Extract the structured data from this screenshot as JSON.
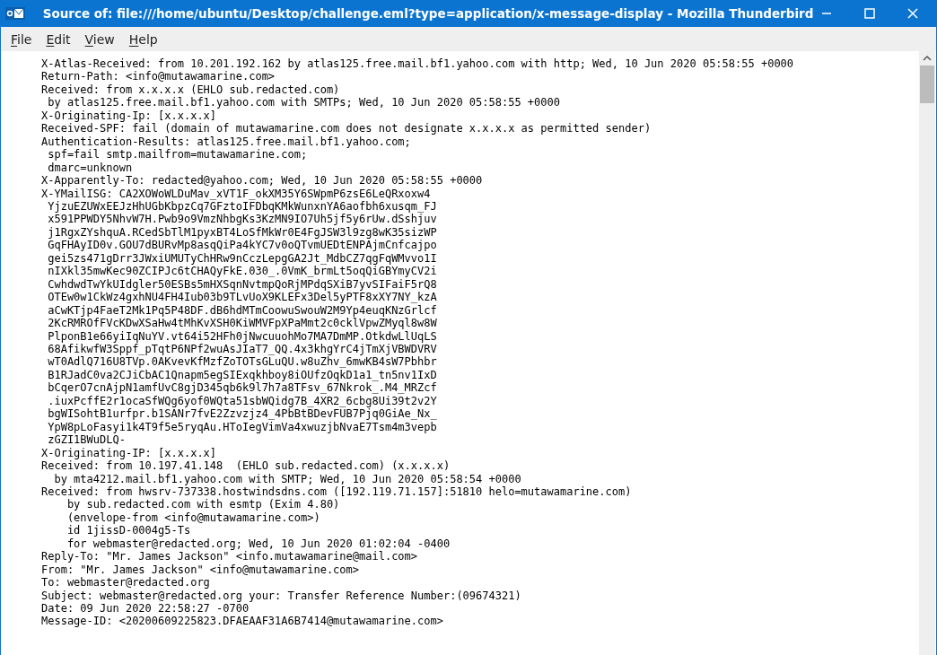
{
  "window": {
    "title": "Source of: file:///home/ubuntu/Desktop/challenge.eml?type=application/x-message-display - Mozilla Thunderbird"
  },
  "menu": [
    {
      "mnemonic": "F",
      "rest": "ile"
    },
    {
      "mnemonic": "E",
      "rest": "dit"
    },
    {
      "mnemonic": "V",
      "rest": "iew"
    },
    {
      "mnemonic": "H",
      "rest": "elp"
    }
  ],
  "source_lines": [
    "X-Atlas-Received: from 10.201.192.162 by atlas125.free.mail.bf1.yahoo.com with http; Wed, 10 Jun 2020 05:58:55 +0000",
    "Return-Path: <info@mutawamarine.com>",
    "Received: from x.x.x.x (EHLO sub.redacted.com)",
    " by atlas125.free.mail.bf1.yahoo.com with SMTPs; Wed, 10 Jun 2020 05:58:55 +0000",
    "X-Originating-Ip: [x.x.x.x]",
    "Received-SPF: fail (domain of mutawamarine.com does not designate x.x.x.x as permitted sender)",
    "Authentication-Results: atlas125.free.mail.bf1.yahoo.com;",
    " spf=fail smtp.mailfrom=mutawamarine.com;",
    " dmarc=unknown",
    "X-Apparently-To: redacted@yahoo.com; Wed, 10 Jun 2020 05:58:55 +0000",
    "X-YMailISG: CA2XOWoWLDuMav_xVT1F_okXM35Y6SWpmP6zsE6LeQRxoxw4",
    " YjzuEZUWxEEJzHhUGbKbpzCq7GFztoIFDbqKMkWunxnYA6aofbh6xusqm_FJ",
    " x591PPWDY5NhvW7H.Pwb9o9VmzNhbgKs3KzMN9IO7Uh5jf5y6rUw.dSshjuv",
    " j1RgxZYshquA.RCedSbTlM1pyxBT4LoSfMkWr0E4FgJSW3l9zg8wK35sizWP",
    " GqFHAyID0v.GOU7dBURvMp8asqQiPa4kYC7v0oQTvmUEDtENPAjmCnfcajpo",
    " gei5zs471gDrr3JWxiUMUTyChHRw9nCczLepgGA2Jt_MdbCZ7qgFqWMvvo1I",
    " nIXkl35mwKec90ZCIPJc6tCHAQyFkE.030_.0VmK_brmLt5oqQiGBYmyCV2i",
    " CwhdwdTwYkUIdgler50ESBs5mHXSqnNvtmpQoRjMPdqSXiB7yvSIFaiF5rQ8",
    " OTEw0w1CkWz4gxhNU4FH4Iub03b9TLvUoX9KLEFx3Del5yPTF8xXY7NY_kzA",
    " aCwKTjp4FaeT2Mk1Pq5P48DF.dB6hdMTmCoowuSwouW2M9Yp4euqKNzGrlcf",
    " 2KcRMROfFVcKDwXSaHw4tMhKvXSH0KiWMVFpXPaMmt2c0cklVpwZMyql8w8W",
    " PlponB1e66yiIqNuYV.vt64i52HFh0jNwcuuohMo7MA7DmMP.OtkdwLlUqLS",
    " 68AfikwfW3Sppf_pTqtP6NPf2wuAsJIaT7_QQ.4x3khgYrC4jTmXjVBWDVRV",
    " wT0AdlQ716U8TVp.0AKvevKfMzfZoTOTsGLuQU.w8uZhv_6mwKB4sW7Pbhbr",
    " B1RJadC0va2CJiCbAC1Qnapm5egSIExqkhboy8iOUfzOqkD1a1_tn5nv1IxD",
    " bCqerO7cnAjpN1amfUvC8gjD345qb6k9l7h7a8TFsv_67Nkrok_.M4_MRZcf",
    " .iuxPcffE2r1ocaSfWQg6yof0WQta51sbWQidg7B_4XR2_6cbg8Ui39t2v2Y",
    " bgWISohtB1urfpr.b1SANr7fvE2Zzvzjz4_4PbBtBDevFUB7Pjq0GiAe_Nx_",
    " YpW8pLoFasyi1k4T9f5e5ryqAu.HToIegVimVa4xwuzjbNvaE7Tsm4m3vepb",
    " zGZI1BWuDLQ-",
    "X-Originating-IP: [x.x.x.x]",
    "Received: from 10.197.41.148  (EHLO sub.redacted.com) (x.x.x.x)",
    "  by mta4212.mail.bf1.yahoo.com with SMTP; Wed, 10 Jun 2020 05:58:54 +0000",
    "Received: from hwsrv-737338.hostwindsdns.com ([192.119.71.157]:51810 helo=mutawamarine.com)",
    "    by sub.redacted.com with esmtp (Exim 4.80)",
    "    (envelope-from <info@mutawamarine.com>)",
    "    id 1jissD-0004g5-Ts",
    "    for webmaster@redacted.org; Wed, 10 Jun 2020 01:02:04 -0400",
    "Reply-To: \"Mr. James Jackson\" <info.mutawamarine@mail.com>",
    "From: \"Mr. James Jackson\" <info@mutawamarine.com>",
    "To: webmaster@redacted.org",
    "Subject: webmaster@redacted.org your: Transfer Reference Number:(09674321)",
    "Date: 09 Jun 2020 22:58:27 -0700",
    "Message-ID: <20200609225823.DFAEAAF31A6B7414@mutawamarine.com>"
  ]
}
